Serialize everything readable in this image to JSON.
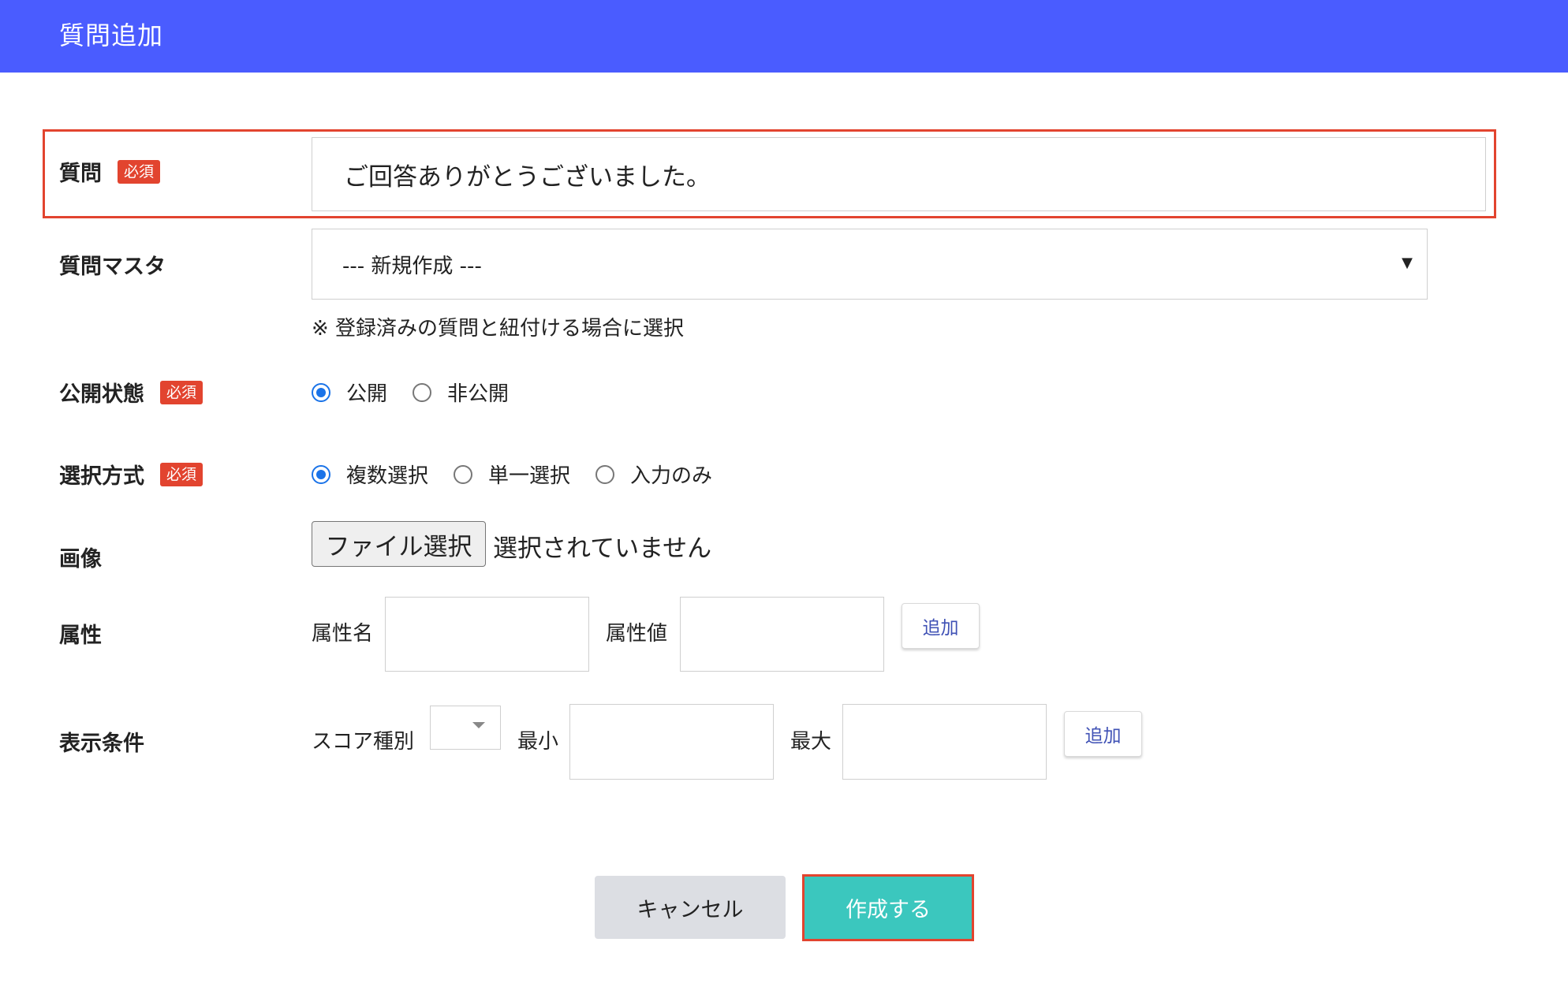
{
  "header": {
    "title": "質問追加"
  },
  "required_badge": "必須",
  "question": {
    "label": "質問",
    "value": "ご回答ありがとうございました。"
  },
  "question_master": {
    "label": "質問マスタ",
    "selected": "--- 新規作成 ---",
    "caret": "▼",
    "note": "※ 登録済みの質問と紐付ける場合に選択"
  },
  "publish_status": {
    "label": "公開状態",
    "options": [
      {
        "label": "公開",
        "checked": true
      },
      {
        "label": "非公開",
        "checked": false
      }
    ]
  },
  "selection_method": {
    "label": "選択方式",
    "options": [
      {
        "label": "複数選択",
        "checked": true
      },
      {
        "label": "単一選択",
        "checked": false
      },
      {
        "label": "入力のみ",
        "checked": false
      }
    ]
  },
  "image": {
    "label": "画像",
    "file_button": "ファイル選択",
    "file_status": "選択されていません"
  },
  "attribute": {
    "label": "属性",
    "name_label": "属性名",
    "value_label": "属性値",
    "add_label": "追加"
  },
  "display_condition": {
    "label": "表示条件",
    "score_type_label": "スコア種別",
    "min_label": "最小",
    "max_label": "最大",
    "add_label": "追加"
  },
  "actions": {
    "cancel_label": "キャンセル",
    "create_label": "作成する"
  },
  "colors": {
    "header": "#4a5cff",
    "required_badge": "#e2442f",
    "highlight": "#e2442f",
    "radio_checked": "#1a73e8",
    "create_button": "#3bc7be",
    "cancel_button": "#dcdee3"
  }
}
